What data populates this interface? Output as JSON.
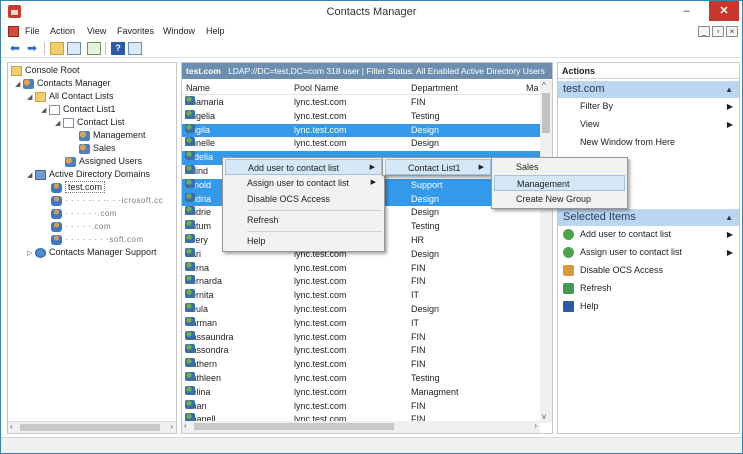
{
  "window": {
    "title": "Contacts Manager",
    "minimize": "–",
    "maximize": "☐",
    "close": "✕"
  },
  "menu": [
    "File",
    "Action",
    "View",
    "Favorites",
    "Window",
    "Help"
  ],
  "tree": {
    "console_root": "Console Root",
    "contacts_manager": "Contacts Manager",
    "all_contact_lists": "All Contact Lists",
    "contact_list1": "Contact List1",
    "contact_list": "Contact List",
    "management": "Management",
    "sales": "Sales",
    "assigned_users": "Assigned Users",
    "ad_domains": "Active Directory Domains",
    "test_com": "test.com",
    "blurred1": "·  ·  ·  ·  ··  ·  ··  ·  ·icrosoft.cc",
    "blurred2": "·  ·  ·  ·  ·  ·.com",
    "blurred3": "·  ·  ·  ·  ·.com",
    "blurred4": "·  ·  ·  ·  ·  ·  ·  ·soft.com",
    "support": "Contacts Manager Support"
  },
  "center": {
    "header_domain": "test.com",
    "header_rest": "LDAP://DC=test,DC=com 318 user  | Filter Status: All Enabled Active Directory Users",
    "col_name": "Name",
    "col_pool": "Pool Name",
    "col_dept": "Department",
    "col_ma": "Ma",
    "rows": [
      {
        "name": "Anamaria",
        "pool": "lync.test.com",
        "dept": "FIN"
      },
      {
        "name": "Angelia",
        "pool": "lync.test.com",
        "dept": "Testing"
      },
      {
        "name": "Angila",
        "pool": "lync.test.com",
        "dept": "Design"
      },
      {
        "name": "Annelle",
        "pool": "lync.test.com",
        "dept": "Design"
      },
      {
        "name": "Ardelia",
        "pool": "",
        "dept": ""
      },
      {
        "name": "Arlind",
        "pool": "",
        "dept": ""
      },
      {
        "name": "Arnold",
        "pool": "",
        "dept": "Support"
      },
      {
        "name": "Audria",
        "pool": "",
        "dept": "Design"
      },
      {
        "name": "Audrie",
        "pool": "",
        "dept": "Design"
      },
      {
        "name": "Autum",
        "pool": "",
        "dept": "Testing"
      },
      {
        "name": "Avery",
        "pool": "",
        "dept": "HR"
      },
      {
        "name": "Bari",
        "pool": "lync.test.com",
        "dept": "Design"
      },
      {
        "name": "Berna",
        "pool": "lync.test.com",
        "dept": "FIN"
      },
      {
        "name": "Bernarda",
        "pool": "lync.test.com",
        "dept": "FIN"
      },
      {
        "name": "Bernita",
        "pool": "lync.test.com",
        "dept": "IT"
      },
      {
        "name": "Beula",
        "pool": "lync.test.com",
        "dept": "Design"
      },
      {
        "name": "Carman",
        "pool": "lync.test.com",
        "dept": "IT"
      },
      {
        "name": "Cassaundra",
        "pool": "lync.test.com",
        "dept": "FIN"
      },
      {
        "name": "Cassondra",
        "pool": "lync.test.com",
        "dept": "FIN"
      },
      {
        "name": "Cathern",
        "pool": "lync.test.com",
        "dept": "FIN"
      },
      {
        "name": "Cathleen",
        "pool": "lync.test.com",
        "dept": "Testing"
      },
      {
        "name": "Celina",
        "pool": "lync.test.com",
        "dept": "Managment"
      },
      {
        "name": "Chan",
        "pool": "lync.test.com",
        "dept": "FIN"
      },
      {
        "name": "Chanell",
        "pool": "lync.test.com",
        "dept": "FIN"
      }
    ]
  },
  "actions": {
    "header": "Actions",
    "section1": "test.com",
    "filter_by": "Filter By",
    "view": "View",
    "new_window": "New Window from Here",
    "section2": "Selected Items",
    "add_user": "Add user to contact list",
    "assign_user": "Assign user to contact list",
    "disable_ocs": "Disable OCS Access",
    "refresh": "Refresh",
    "help": "Help"
  },
  "context_menu": {
    "add_user": "Add user to contact list",
    "assign_user": "Assign user to contact list",
    "disable_ocs": "Disable OCS Access",
    "refresh": "Refresh",
    "help": "Help"
  },
  "submenu1": {
    "contact_list1": "Contact List1"
  },
  "submenu2": {
    "sales": "Sales",
    "management": "Management",
    "create_group": "Create New Group"
  },
  "colors": {
    "selection": "#3399e8",
    "section_header": "#bcd6ef",
    "center_header": "#6c8fb0"
  }
}
